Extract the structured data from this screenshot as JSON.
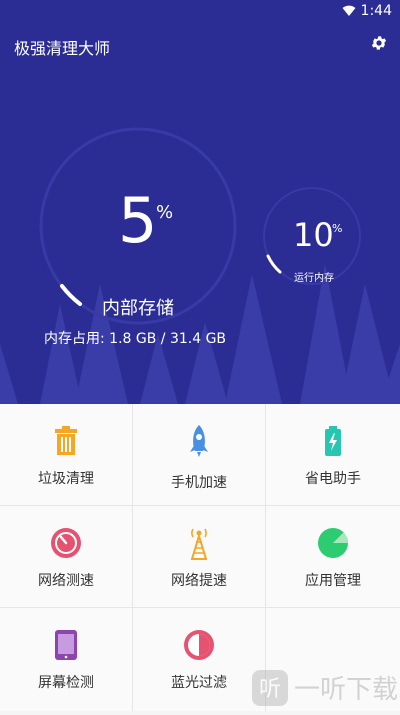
{
  "status": {
    "time": "1:44"
  },
  "app": {
    "title": "极强清理大师",
    "settings_icon": "gear-icon"
  },
  "storage": {
    "percent": "5",
    "percent_sign": "%",
    "label": "内部存储",
    "memory_text": "内存占用: 1.8 GB / 31.4 GB",
    "fill_fraction": 0.05
  },
  "ram": {
    "percent": "10",
    "percent_sign": "%",
    "label": "运行内存",
    "fill_fraction": 0.1
  },
  "colors": {
    "hero_bg": "#2b2d94",
    "orange": "#f5a623",
    "blue": "#4a90e2",
    "teal": "#26c6b0",
    "red": "#e55370",
    "green": "#2ecc71",
    "purple": "#8e44ad"
  },
  "tools": [
    {
      "label": "垃圾清理",
      "icon": "trash-icon"
    },
    {
      "label": "手机加速",
      "icon": "rocket-icon"
    },
    {
      "label": "省电助手",
      "icon": "battery-icon"
    },
    {
      "label": "网络测速",
      "icon": "speedometer-icon"
    },
    {
      "label": "网络提速",
      "icon": "signal-tower-icon"
    },
    {
      "label": "应用管理",
      "icon": "pie-chart-icon"
    },
    {
      "label": "屏幕检测",
      "icon": "tablet-icon"
    },
    {
      "label": "蓝光过滤",
      "icon": "half-circle-icon"
    }
  ],
  "watermark": {
    "text": "一听下载",
    "logo_text": "听"
  }
}
